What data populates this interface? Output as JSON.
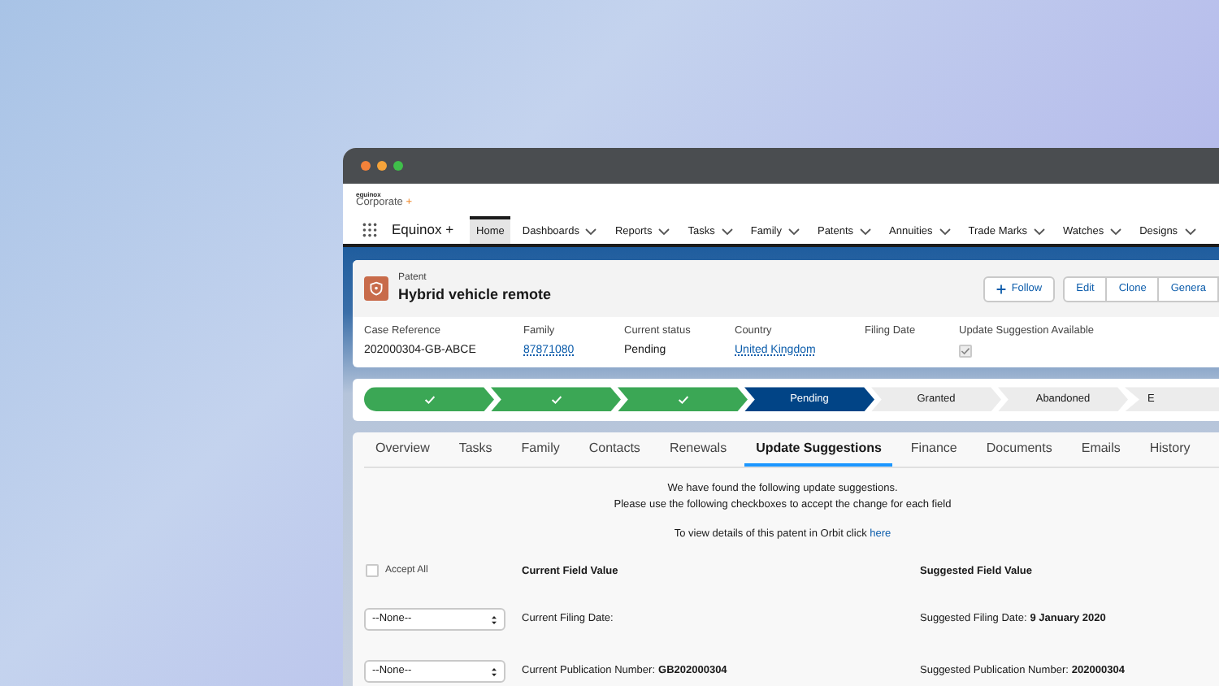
{
  "header": {
    "brand_small": "equinox",
    "brand": "Corporate",
    "brand_plus": "+"
  },
  "nav": {
    "app_name": "Equinox +",
    "items": [
      {
        "label": "Home",
        "selected": true,
        "has_menu": false
      },
      {
        "label": "Dashboards",
        "selected": false,
        "has_menu": true
      },
      {
        "label": "Reports",
        "selected": false,
        "has_menu": true
      },
      {
        "label": "Tasks",
        "selected": false,
        "has_menu": true
      },
      {
        "label": "Family",
        "selected": false,
        "has_menu": true
      },
      {
        "label": "Patents",
        "selected": false,
        "has_menu": true
      },
      {
        "label": "Annuities",
        "selected": false,
        "has_menu": true
      },
      {
        "label": "Trade Marks",
        "selected": false,
        "has_menu": true
      },
      {
        "label": "Watches",
        "selected": false,
        "has_menu": true
      },
      {
        "label": "Designs",
        "selected": false,
        "has_menu": true
      }
    ]
  },
  "record": {
    "type": "Patent",
    "title": "Hybrid vehicle remote",
    "buttons": [
      {
        "label": "Follow",
        "kind": "follow"
      },
      {
        "label": "Edit",
        "kind": "plain"
      },
      {
        "label": "Clone",
        "kind": "plain"
      },
      {
        "label": "Genera",
        "kind": "plain"
      }
    ],
    "fields": [
      {
        "label": "Case Reference",
        "kind": "text",
        "value": "202000304-GB-ABCE"
      },
      {
        "label": "Family",
        "kind": "link",
        "value": "87871080"
      },
      {
        "label": "Current status",
        "kind": "text",
        "value": "Pending"
      },
      {
        "label": "Country",
        "kind": "link",
        "value": "United Kingdom"
      },
      {
        "label": "Filing Date",
        "kind": "text"
      },
      {
        "label": "Update Suggestion Available",
        "kind": "checkbox",
        "checked": true
      }
    ]
  },
  "path": [
    {
      "kind": "complete"
    },
    {
      "kind": "complete"
    },
    {
      "kind": "complete"
    },
    {
      "kind": "current",
      "label": "Pending"
    },
    {
      "kind": "upcoming",
      "label": "Granted"
    },
    {
      "kind": "upcoming",
      "label": "Abandoned"
    },
    {
      "kind": "upcoming",
      "label": "E"
    }
  ],
  "tabs": [
    {
      "label": "Overview",
      "selected": false
    },
    {
      "label": "Tasks",
      "selected": false
    },
    {
      "label": "Family",
      "selected": false
    },
    {
      "label": "Contacts",
      "selected": false
    },
    {
      "label": "Renewals",
      "selected": false
    },
    {
      "label": "Update Suggestions",
      "selected": true
    },
    {
      "label": "Finance",
      "selected": false
    },
    {
      "label": "Documents",
      "selected": false
    },
    {
      "label": "Emails",
      "selected": false
    },
    {
      "label": "History",
      "selected": false
    }
  ],
  "suggestions": {
    "intro": [
      "We have found the following update suggestions.",
      "Please use the following checkboxes to accept the change for each field"
    ],
    "orbit_text": "To view details of this patent in Orbit click",
    "orbit_link": "here",
    "accept_all": {
      "label": "Accept All",
      "checked": false
    },
    "current_heading": "Current Field Value",
    "suggested_heading": "Suggested Field Value",
    "rows": [
      {
        "choice": "--None--",
        "current_label": "Current Filing Date:",
        "suggested_label": "Suggested Filing Date:",
        "suggested_value": "9 January 2020"
      },
      {
        "choice": "--None--",
        "current_label": "Current Publication Number:",
        "current_value": "GB202000304",
        "suggested_label": "Suggested Publication Number:",
        "suggested_value": "202000304"
      }
    ]
  }
}
